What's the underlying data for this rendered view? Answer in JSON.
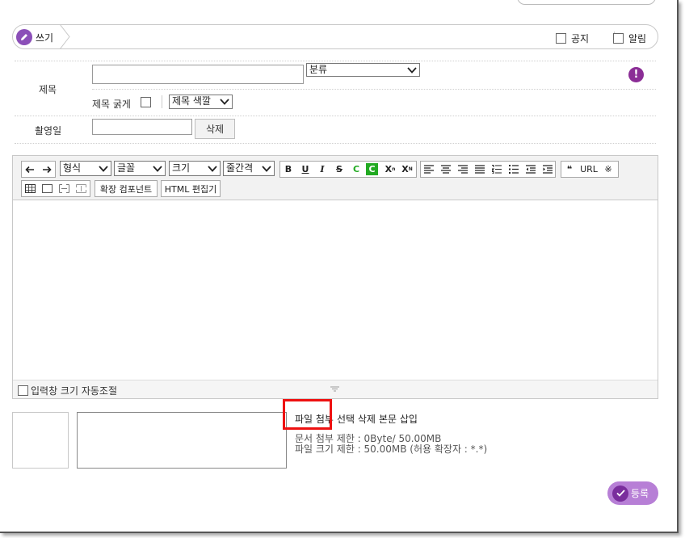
{
  "header": {
    "write_label": "쓰기",
    "notice_label": "공지",
    "alert_label": "알림"
  },
  "form": {
    "title_label": "제목",
    "title_value": "",
    "category_select": "분류",
    "bold_label": "제목 굵게",
    "color_select": "제목 색깔",
    "date_label": "촬영일",
    "date_value": "",
    "delete_button": "삭제",
    "alert_icon_text": "!"
  },
  "toolbar": {
    "format_select": "형식",
    "font_select": "글꼴",
    "size_select": "크기",
    "line_select": "줄간격",
    "bold": "B",
    "underline": "U",
    "italic": "I",
    "strike": "S",
    "font_color": "C",
    "bg_color": "C",
    "superscript": "X",
    "subscript": "X",
    "quote": "❝",
    "url": "URL",
    "special_char": "※",
    "extend_component": "확장 컴포넌트",
    "html_editor": "HTML 편집기"
  },
  "editor": {
    "content": "",
    "auto_resize_label": "입력창 크기 자동조절"
  },
  "attachment": {
    "attach_file": "파일 첨부",
    "delete_selected": "선택 삭제",
    "insert_body": "본문 삽입",
    "doc_limit": "문서 첨부 제한 : 0Byte/ 50.00MB",
    "file_limit": "파일 크기 제한 : 50.00MB (허용 확장자 : *.*)"
  },
  "submit": {
    "label": "등록"
  },
  "colors": {
    "accent": "#8b4fb8",
    "submit_bg": "#b77fd6",
    "highlight": "#ee1111",
    "font_color_green": "#22aa22"
  }
}
